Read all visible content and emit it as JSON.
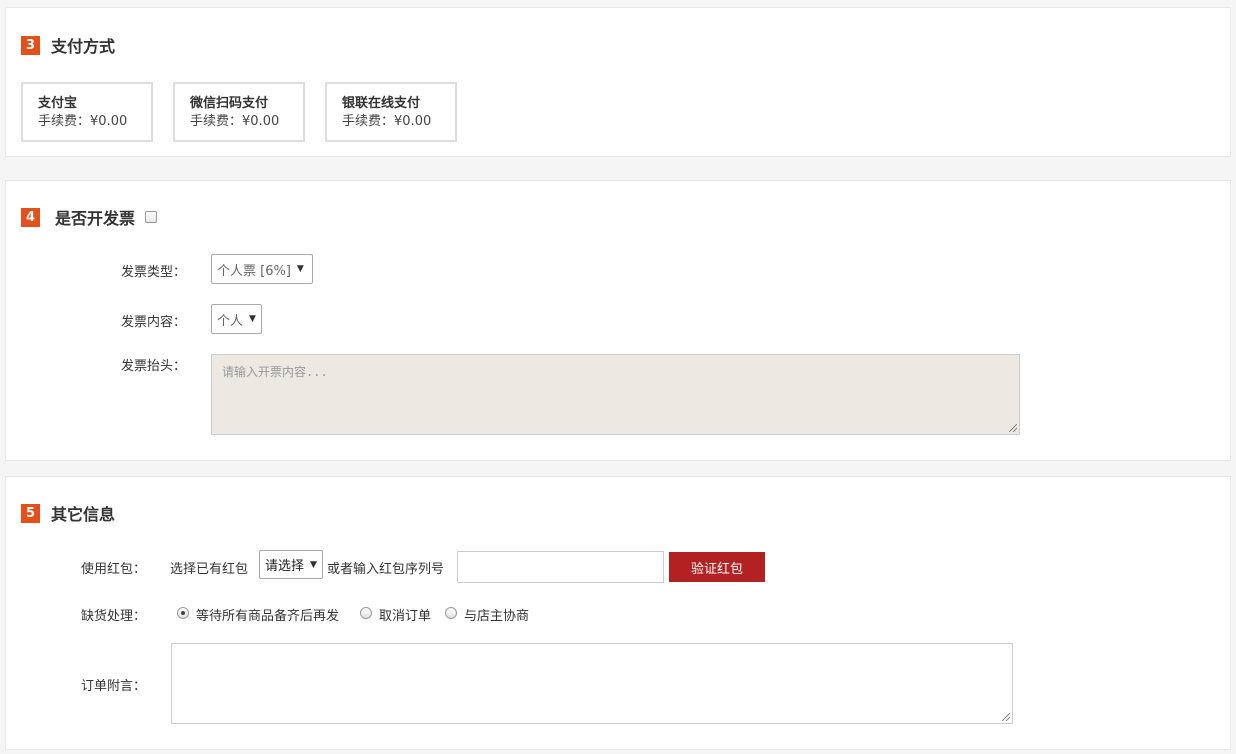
{
  "payment": {
    "number": "3",
    "title": "支付方式",
    "methods": [
      {
        "name": "支付宝",
        "fee_label": "手续费：",
        "fee": "¥0.00"
      },
      {
        "name": "微信扫码支付",
        "fee_label": "手续费：",
        "fee": "¥0.00"
      },
      {
        "name": "银联在线支付",
        "fee_label": "手续费：",
        "fee": "¥0.00"
      }
    ]
  },
  "invoice": {
    "number": "4",
    "title": "是否开发票",
    "checked": false,
    "type_label": "发票类型：",
    "type_value": "个人票 [6%]",
    "content_label": "发票内容：",
    "content_value": "个人",
    "header_label": "发票抬头：",
    "header_placeholder": "请输入开票内容..."
  },
  "other": {
    "number": "5",
    "title": "其它信息",
    "redpacket_label": "使用红包：",
    "redpacket_select_prefix": "选择已有红包",
    "redpacket_select_value": "请选择",
    "redpacket_or_text": "或者输入红包序列号",
    "redpacket_input_value": "",
    "verify_button": "验证红包",
    "stockout_label": "缺货处理：",
    "stockout_options": [
      "等待所有商品备齐后再发",
      "取消订单",
      "与店主协商"
    ],
    "stockout_selected": 0,
    "note_label": "订单附言：",
    "note_value": ""
  },
  "colors": {
    "accent": "#e4501b",
    "button": "#b22222",
    "textarea_disabled_bg": "#ebe9e2"
  }
}
